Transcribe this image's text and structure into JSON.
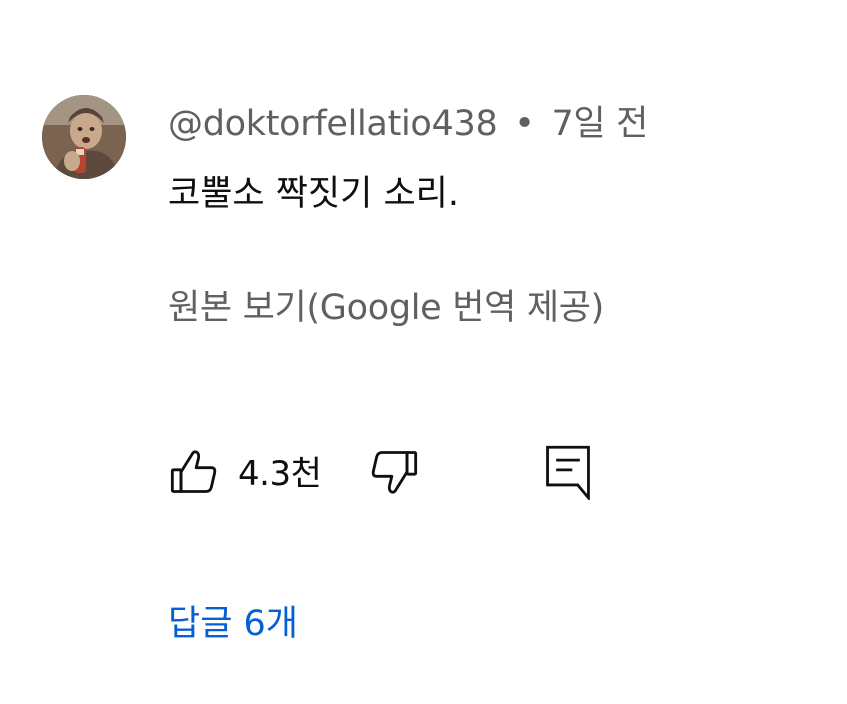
{
  "comment": {
    "author": "@doktorfellatio438",
    "separator": "•",
    "time": "7일 전",
    "text": "코뿔소 짝짓기 소리.",
    "translate_label": "원본 보기(Google 번역 제공)",
    "like_count": "4.3천",
    "replies_label": "답글 6개"
  },
  "icons": {
    "like": "thumb-up-icon",
    "dislike": "thumb-down-icon",
    "reply": "reply-comment-icon"
  },
  "colors": {
    "primary_text": "#0f0f0f",
    "secondary_text": "#606060",
    "link_blue": "#065fd4"
  }
}
